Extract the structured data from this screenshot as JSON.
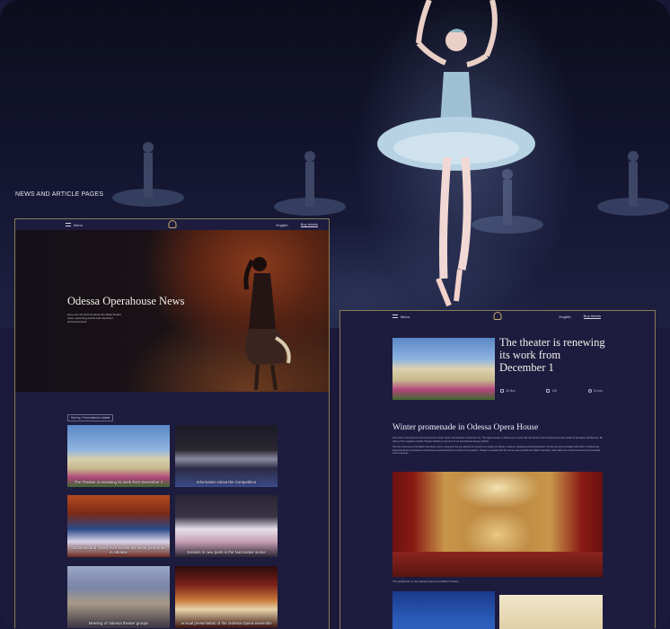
{
  "section_label": "NEWS AND ARTICLE PAGES",
  "nav": {
    "menu_label": "Menu",
    "language": "English",
    "buy_tickets": "Buy tickets"
  },
  "news_page": {
    "title": "Odessa Operahouse News",
    "subtitle": "Here you can find out about the latest theater news, upcoming events and important announcements",
    "sort_label": "Sort by: From latest to oldest",
    "cards": [
      {
        "caption": "The Theater is renewing its work from December 1"
      },
      {
        "caption": "Information About the Competition"
      },
      {
        "caption": "Orchestra and choirs from across the world performed in Ukraine"
      },
      {
        "caption": "Soloists in new parts in the Nutcracker scene"
      },
      {
        "caption": "Meeting of Odessa theater groups"
      },
      {
        "caption": "Annual presentation of the Odessa Opera ensemble"
      }
    ]
  },
  "article_page": {
    "title": "The theater is renewing its work from December 1",
    "meta": {
      "date": "26 Nov",
      "views": "140",
      "read_time": "10 min"
    },
    "section_heading": "Winter promenade in Odessa Opera House",
    "paragraphs": [
      "One of the most famous monuments of the world culture, the business card of the city. The Opera House in Odessa is on a par with the famous Vienna Opera and other pearls of European architecture. By rating of the magazine Forbes Theater building on the list of 'Lviv and Odessa' Europe (2010).",
      "The city is famous as the Black Sea Pearl, since a long time the city attracts the crowd of a merger of cultures, customs, character and temperament. So the role of the portable units built in Odessa has absorbed all the impressions of inheritance accompanied by rhythms of its quarters. Theater compared with the old as early as 1810 and 1920 it was then, was called one of the lavish and most beautiful ones in Europe."
    ],
    "image_caption": "The auditorium in the Odessa Opera and Ballet Theatre"
  }
}
